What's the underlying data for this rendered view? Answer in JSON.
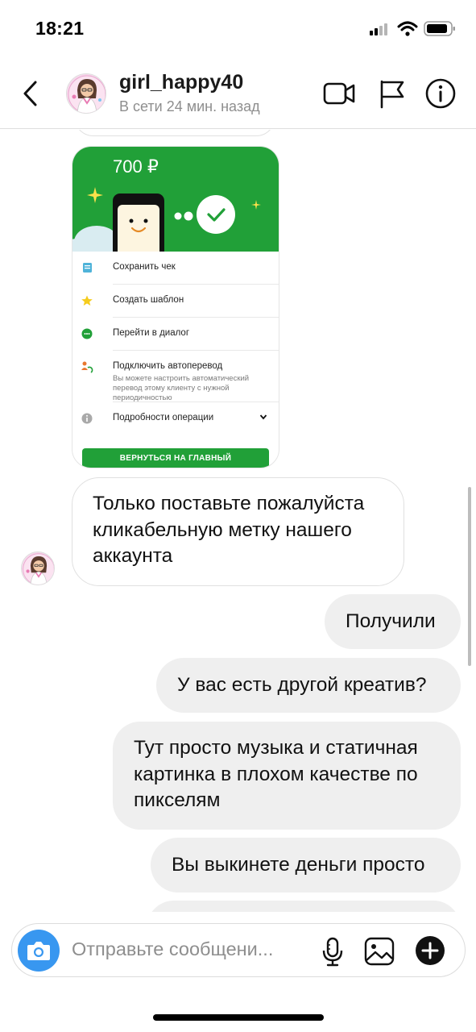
{
  "status_bar": {
    "time": "18:21"
  },
  "header": {
    "username": "girl_happy40",
    "last_seen": "В сети 24 мин. назад"
  },
  "receipt": {
    "amount": "700 ₽",
    "items": [
      {
        "icon": "receipt-icon",
        "label": "Сохранить чек"
      },
      {
        "icon": "star-icon",
        "label": "Создать шаблон"
      },
      {
        "icon": "chat-icon",
        "label": "Перейти в диалог"
      },
      {
        "icon": "autotransfer-icon",
        "label": "Подключить автоперевод",
        "sub": "Вы можете настроить автоматический перевод этому клиенту с нужной периодичностью"
      },
      {
        "icon": "info-icon",
        "label": "Подробности операции"
      }
    ],
    "button_label": "ВЕРНУТЬСЯ НА ГЛАВНЫЙ"
  },
  "messages": [
    {
      "direction": "in",
      "lines": [
        "Только поставьте пожалуйста",
        "кликабельную метку нашего",
        "аккаунта"
      ]
    },
    {
      "direction": "out",
      "lines": [
        "Получили"
      ]
    },
    {
      "direction": "out",
      "lines": [
        "У вас есть другой креатив?"
      ]
    },
    {
      "direction": "out",
      "lines": [
        "Тут просто музыка и статичная",
        "картинка в плохом качестве по",
        "пикселям"
      ]
    },
    {
      "direction": "out",
      "lines": [
        "Вы выкинете деньги просто"
      ]
    }
  ],
  "composer": {
    "placeholder": "Отправьте сообщени..."
  },
  "colors": {
    "accent": "#3897f0",
    "sber_green": "#21a038",
    "bubble_out": "#efefef"
  }
}
